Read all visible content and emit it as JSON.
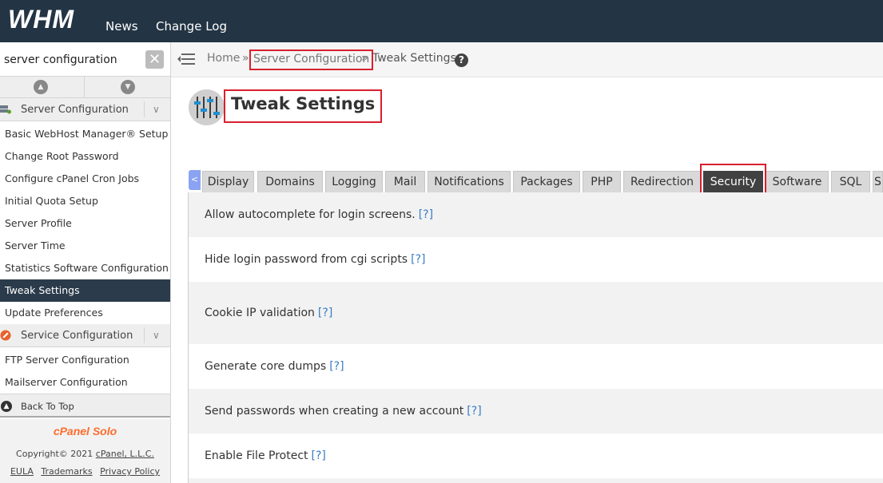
{
  "header": {
    "logo": "WHM",
    "nav": [
      "News",
      "Change Log"
    ]
  },
  "sidebar": {
    "search": {
      "value": "server configuration",
      "placeholder": ""
    },
    "sections": [
      {
        "label": "Server Configuration",
        "items": [
          {
            "label": "Basic WebHost Manager® Setup",
            "active": false
          },
          {
            "label": "Change Root Password",
            "active": false
          },
          {
            "label": "Configure cPanel Cron Jobs",
            "active": false
          },
          {
            "label": "Initial Quota Setup",
            "active": false
          },
          {
            "label": "Server Profile",
            "active": false
          },
          {
            "label": "Server Time",
            "active": false
          },
          {
            "label": "Statistics Software Configuration",
            "active": false
          },
          {
            "label": "Tweak Settings",
            "active": true
          },
          {
            "label": "Update Preferences",
            "active": false
          }
        ]
      },
      {
        "label": "Service Configuration",
        "items": [
          {
            "label": "FTP Server Configuration",
            "active": false
          },
          {
            "label": "Mailserver Configuration",
            "active": false
          }
        ]
      }
    ],
    "back_to_top": "Back To Top",
    "footer": {
      "brand": "cPanel Solo",
      "copyright_prefix": "Copyright© 2021",
      "copyright_company": "cPanel, L.L.C.",
      "links": [
        "EULA",
        "Trademarks",
        "Privacy Policy"
      ]
    }
  },
  "breadcrumb": {
    "home": "Home",
    "separator": "»",
    "section": "Server Configuration",
    "current": "Tweak Settings",
    "help": "?"
  },
  "page": {
    "title": "Tweak Settings"
  },
  "tabs": {
    "scroll_left": "<",
    "items": [
      "Display",
      "Domains",
      "Logging",
      "Mail",
      "Notifications",
      "Packages",
      "PHP",
      "Redirection",
      "Security",
      "Software",
      "SQL",
      "S"
    ],
    "active": "Security"
  },
  "settings": {
    "help_label": "[?]",
    "rows": [
      "Allow autocomplete for login screens.",
      "Hide login password from cgi scripts",
      "Cookie IP validation",
      "Generate core dumps",
      "Send passwords when creating a new account",
      "Enable File Protect"
    ]
  },
  "colors": {
    "topbar": "#233444",
    "highlight_box": "#d9202d",
    "active_tab": "#414141",
    "active_menu": "#2b3b4b",
    "brand_orange": "#ff6c2c",
    "help_link": "#3a7cc5"
  }
}
